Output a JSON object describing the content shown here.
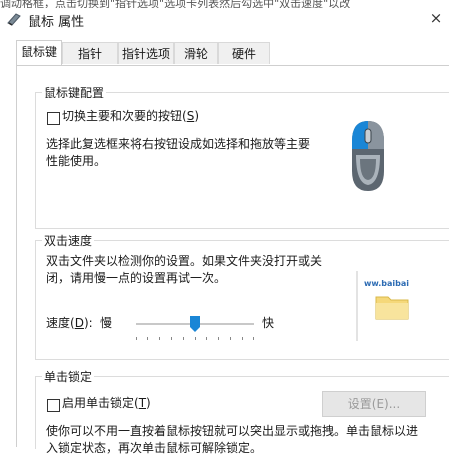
{
  "top_fragment": "调动格框，点击切换到\"指针选项\"选项卡列表然后勾选中\"双击速度\"以改",
  "window": {
    "title": "鼠标 属性",
    "close_glyph": "×"
  },
  "tabs": [
    {
      "label": "鼠标键",
      "active": true
    },
    {
      "label": "指针",
      "active": false
    },
    {
      "label": "指针选项",
      "active": false
    },
    {
      "label": "滑轮",
      "active": false
    },
    {
      "label": "硬件",
      "active": false
    }
  ],
  "button_config": {
    "heading": "鼠标键配置",
    "swap_checkbox_label_pre": "切换主要和次要的按钮(",
    "swap_checkbox_key": "S",
    "swap_checkbox_label_post": ")",
    "swap_checked": false,
    "description_line1": "选择此复选框来将右按钮设成如选择和拖放等主要",
    "description_line2": "性能使用。"
  },
  "double_click": {
    "heading": "双击速度",
    "description_line1": "双击文件夹以检测你的设置。如果文件夹没打开或关",
    "description_line2": "闭，请用慢一点的设置再试一次。",
    "speed_label_pre": "速度(",
    "speed_key": "D",
    "speed_label_post": "):",
    "slow_label": "慢",
    "fast_label": "快",
    "speed_level": 0.5,
    "folder_text": "ww.baibai"
  },
  "click_lock": {
    "heading": "单击锁定",
    "checkbox_label_pre": "启用单击锁定(",
    "checkbox_key": "T",
    "checkbox_label_post": ")",
    "checked": false,
    "settings_button": "设置(E)...",
    "description_line1": "使你可以不用一直按着鼠标按钮就可以突出显示或拖拽。单击鼠标以进",
    "description_line2": "入锁定状态，再次单击鼠标可解除锁定。"
  },
  "colors": {
    "accent": "#1a86d6",
    "mouse_body": "#5c6670"
  }
}
